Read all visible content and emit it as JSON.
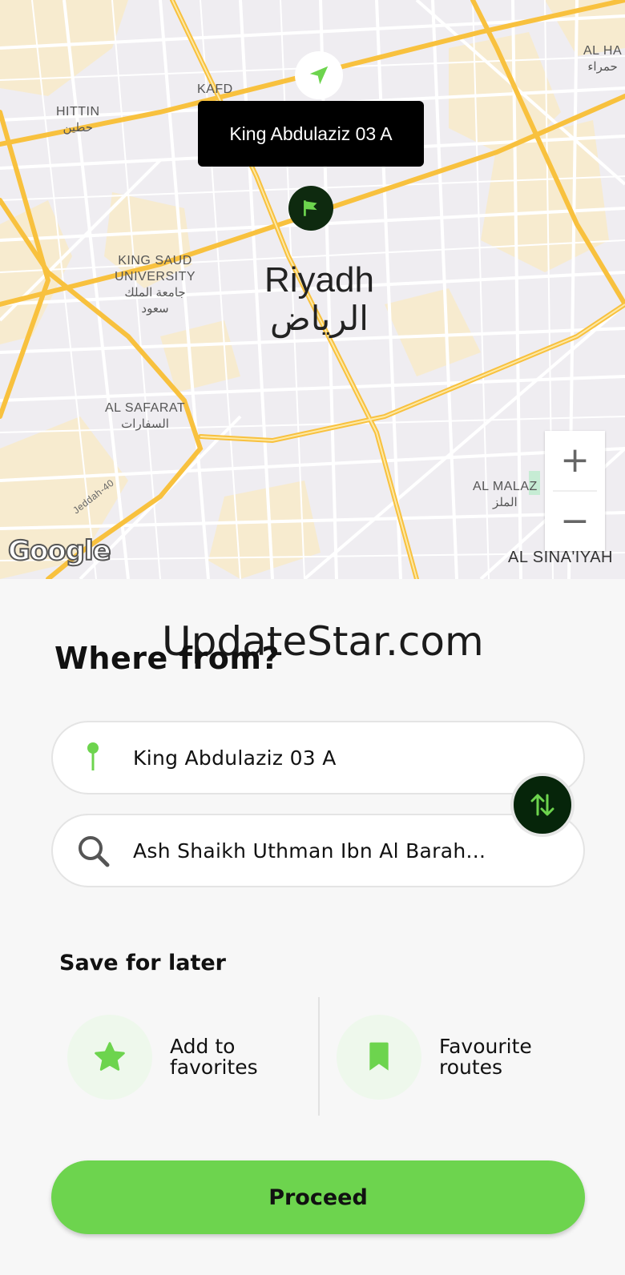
{
  "map": {
    "tooltip": "King Abdulaziz 03 A",
    "city_en": "Riyadh",
    "city_ar": "الرياض",
    "labels": {
      "hittin_en": "HITTIN",
      "hittin_ar": "حطين",
      "kafd": "KAFD",
      "al_ha": "AL HA",
      "al_ha_ar": "حمراء",
      "ksu_en": "KING SAUD\nUNIVERSITY",
      "ksu_ar": "جامعة الملك\nسعود",
      "safarat_en": "AL SAFARAT",
      "safarat_ar": "السفارات",
      "malaz_en": "AL MALAZ",
      "malaz_ar": "الملز",
      "sinaiyah_en": "AL SINA'IYAH",
      "road": "Jeddah-40"
    },
    "zoom_in": "+",
    "zoom_out": "−",
    "logo": "Google",
    "icons": {
      "nav": "navigation-arrow-icon",
      "flag": "flag-icon"
    }
  },
  "watermark": "UpdateStar.com",
  "title": "Where from?",
  "from_value": "King Abdulaziz 03 A",
  "to_value": "Ash Shaikh Uthman Ibn Al Barah...",
  "save_title": "Save for later",
  "add_favorites": "Add to\nfavorites",
  "favourite_routes": "Favourite\nroutes",
  "proceed": "Proceed",
  "colors": {
    "accent": "#6dd44e",
    "dark_green": "#06250a",
    "road": "#f8c13e"
  }
}
